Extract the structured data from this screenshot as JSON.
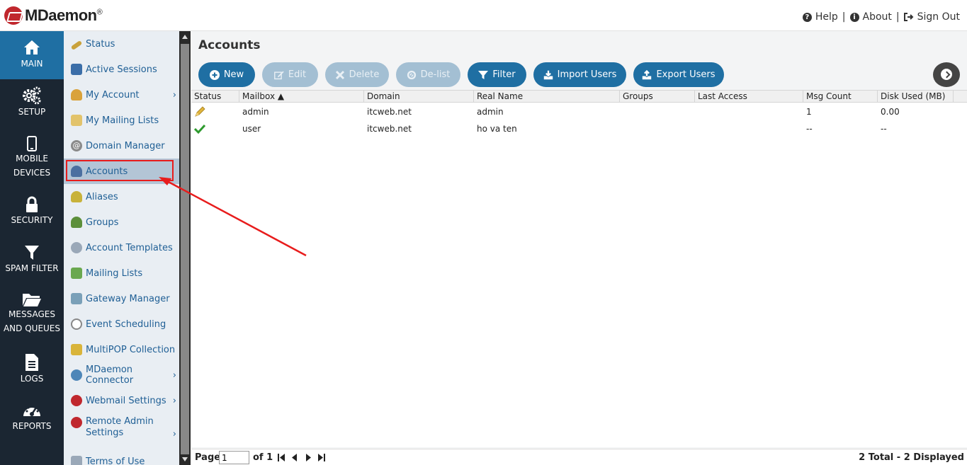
{
  "header": {
    "logo_text": "MDaemon",
    "logo_reg": "®",
    "help": "Help",
    "about": "About",
    "sign_out": "Sign Out",
    "sep": "|"
  },
  "mainnav": [
    {
      "label": "MAIN",
      "icon": "home-icon"
    },
    {
      "label": "SETUP",
      "icon": "gears-icon"
    },
    {
      "label": "MOBILE DEVICES",
      "icon": "mobile-icon"
    },
    {
      "label": "SECURITY",
      "icon": "lock-icon"
    },
    {
      "label": "SPAM FILTER",
      "icon": "filter-icon"
    },
    {
      "label": "MESSAGES AND QUEUES",
      "icon": "folder-icon"
    },
    {
      "label": "LOGS",
      "icon": "document-icon"
    },
    {
      "label": "REPORTS",
      "icon": "dashboard-icon"
    }
  ],
  "submenu": [
    {
      "label": "Status",
      "icon": "status-icon"
    },
    {
      "label": "Active Sessions",
      "icon": "sessions-icon"
    },
    {
      "label": "My Account",
      "icon": "account-icon",
      "chevron": "›"
    },
    {
      "label": "My Mailing Lists",
      "icon": "mailing-list-icon"
    },
    {
      "label": "Domain Manager",
      "icon": "at-icon"
    },
    {
      "label": "Accounts",
      "icon": "accounts-icon"
    },
    {
      "label": "Aliases",
      "icon": "aliases-icon"
    },
    {
      "label": "Groups",
      "icon": "groups-icon"
    },
    {
      "label": "Account Templates",
      "icon": "templates-icon"
    },
    {
      "label": "Mailing Lists",
      "icon": "lists-icon"
    },
    {
      "label": "Gateway Manager",
      "icon": "gateway-icon"
    },
    {
      "label": "Event Scheduling",
      "icon": "clock-icon"
    },
    {
      "label": "MultiPOP Collection",
      "icon": "multipop-icon"
    },
    {
      "label": "MDaemon Connector",
      "icon": "connector-icon",
      "chevron": "›"
    },
    {
      "label": "Webmail Settings",
      "icon": "webmail-icon",
      "chevron": "›"
    },
    {
      "label": "Remote Admin Settings",
      "icon": "remote-admin-icon",
      "chevron": "›"
    },
    {
      "label": "Terms of Use",
      "icon": "terms-icon"
    }
  ],
  "content": {
    "title": "Accounts",
    "toolbar": {
      "new": "New",
      "edit": "Edit",
      "delete": "Delete",
      "delist": "De-list",
      "filter": "Filter",
      "import": "Import Users",
      "export": "Export Users"
    },
    "columns": [
      "Status",
      "Mailbox ▲",
      "Domain",
      "Real Name",
      "Groups",
      "Last Access",
      "Msg Count",
      "Disk Used (MB)"
    ],
    "rows": [
      {
        "status_icon": "admin-pencil-icon",
        "mailbox": "admin",
        "domain": "itcweb.net",
        "real_name": "admin",
        "groups": "",
        "last_access": "",
        "msg_count": "1",
        "disk_used": "0.00"
      },
      {
        "status_icon": "checkmark-icon",
        "mailbox": "user",
        "domain": "itcweb.net",
        "real_name": "ho va ten",
        "groups": "",
        "last_access": "",
        "msg_count": "--",
        "disk_used": "--"
      }
    ],
    "footer": {
      "page_label": "Page",
      "page_value": "1",
      "of_label": "of 1",
      "total": "2 Total - 2 Displayed"
    }
  },
  "colors": {
    "nav_bg": "#1b2632",
    "nav_active": "#1f6fa3",
    "button": "#1f6fa3",
    "button_disabled": "#a3bfd3",
    "annotation": "#e81c1c"
  }
}
